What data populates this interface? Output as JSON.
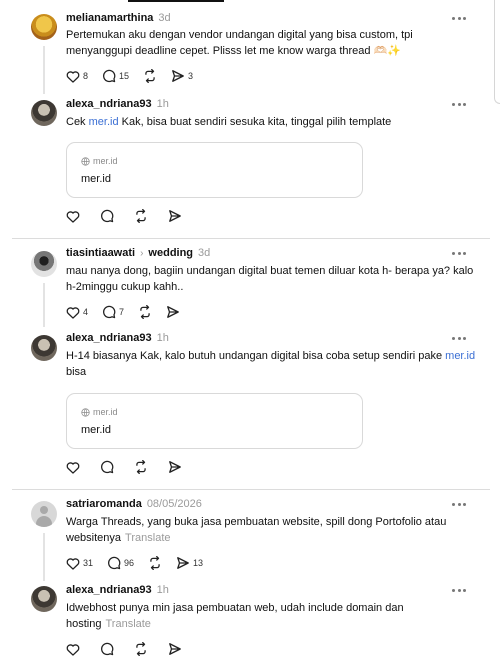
{
  "posts": [
    {
      "user": "melianamarthina",
      "time": "3d",
      "text": "Pertemukan aku dengan vendor undangan digital yang bisa custom, tpi menyanggupi deadline cepet. Plisss let me know warga thread 🫶🏻✨",
      "likes": "8",
      "replies": "15",
      "reposts": "",
      "shares": "3"
    },
    {
      "user": "alexa_ndriana93",
      "time": "1h",
      "text_before": "Cek ",
      "link": "mer.id",
      "text_after": " Kak, bisa buat sendiri sesuka kita, tinggal pilih template",
      "card": {
        "domain": "mer.id",
        "title": "mer.id"
      }
    },
    {
      "user": "tiasintiaawati",
      "topic": "wedding",
      "time": "3d",
      "text": "mau nanya dong, bagiin undangan digital buat temen diluar kota h- berapa ya? kalo h-2minggu cukup kahh..",
      "likes": "4",
      "replies": "7"
    },
    {
      "user": "alexa_ndriana93",
      "time": "1h",
      "text_before": "H-14 biasanya Kak, kalo butuh undangan digital bisa coba setup sendiri pake ",
      "link": "mer.id",
      "text_after": " bisa",
      "card": {
        "domain": "mer.id",
        "title": "mer.id"
      }
    },
    {
      "user": "satriaromanda",
      "time": "08/05/2026",
      "text": "Warga Threads, yang buka jasa pembuatan website, spill dong Portofolio atau websitenya",
      "translate": "Translate",
      "likes": "31",
      "replies": "96",
      "shares": "13"
    },
    {
      "user": "alexa_ndriana93",
      "time": "1h",
      "text": "Idwebhost punya min jasa pembuatan web, udah include domain dan hosting",
      "translate": "Translate"
    }
  ],
  "icons": [
    "heart-icon",
    "comment-icon",
    "repost-icon",
    "share-icon",
    "more-icon",
    "globe-icon"
  ],
  "colors": {
    "link": "#3b6fd4",
    "muted": "#9a9a9a",
    "separator": "#dcdcdc"
  }
}
